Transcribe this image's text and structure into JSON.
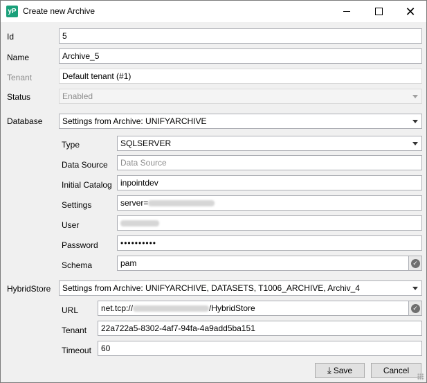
{
  "window": {
    "title": "Create new Archive",
    "app_icon": "yP"
  },
  "labels": {
    "id": "Id",
    "name": "Name",
    "tenant": "Tenant",
    "status": "Status",
    "database": "Database",
    "type": "Type",
    "data_source": "Data Source",
    "initial_catalog": "Initial Catalog",
    "settings": "Settings",
    "user": "User",
    "password": "Password",
    "schema": "Schema",
    "hybridstore": "HybridStore",
    "url": "URL",
    "hs_tenant": "Tenant",
    "timeout": "Timeout"
  },
  "fields": {
    "id": "5",
    "name": "Archive_5",
    "tenant": "Default tenant (#1)",
    "status": "Enabled",
    "database": "Settings from Archive: UNIFYARCHIVE",
    "type": "SQLSERVER",
    "data_source_placeholder": "Data Source",
    "initial_catalog": "inpointdev",
    "settings_prefix": "server=",
    "password_mask": "••••••••••",
    "schema": "pam",
    "hybridstore": "Settings from Archive: UNIFYARCHIVE, DATASETS, T1006_ARCHIVE, Archiv_4",
    "url_prefix": "net.tcp://",
    "url_suffix": "/HybridStore",
    "hs_tenant": "22a722a5-8302-4af7-94fa-4a9add5ba151",
    "timeout": "60"
  },
  "buttons": {
    "save": "Save",
    "cancel": "Cancel"
  },
  "icons": {
    "minimize": "minimize-icon",
    "maximize": "maximize-icon",
    "close": "close-icon",
    "dropdown": "chevron-down-icon",
    "check": "check-circle-icon",
    "save": "download-icon"
  }
}
